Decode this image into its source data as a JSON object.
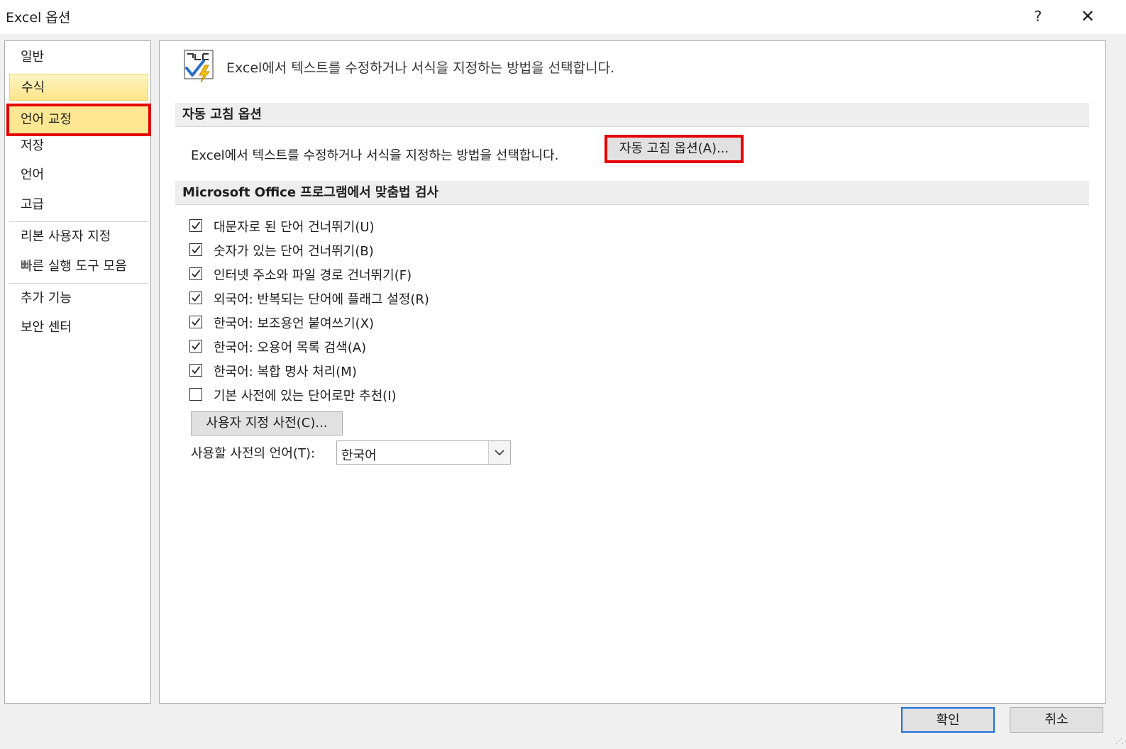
{
  "window": {
    "title": "Excel 옵션",
    "help_glyph": "?",
    "close_glyph": "✕"
  },
  "sidebar": {
    "items": [
      {
        "label": "일반"
      },
      {
        "label": "수식"
      },
      {
        "label": "언어 교정"
      },
      {
        "label": "저장"
      },
      {
        "label": "언어"
      },
      {
        "label": "고급"
      },
      {
        "label": "리본 사용자 지정"
      },
      {
        "label": "빠른 실행 도구 모음"
      },
      {
        "label": "추가 기능"
      },
      {
        "label": "보안 센터"
      }
    ]
  },
  "main": {
    "header_icon": "abc-check-proofing-icon",
    "header_text": "Excel에서 텍스트를 수정하거나 서식을 지정하는 방법을 선택합니다.",
    "autocorrect_section": {
      "title": "자동 고침 옵션",
      "description": "Excel에서 텍스트를 수정하거나 서식을 지정하는 방법을 선택합니다.",
      "button_label": "자동 고침 옵션(A)..."
    },
    "spelling_section": {
      "title": "Microsoft Office 프로그램에서 맞춤법 검사",
      "checkboxes": [
        {
          "label": "대문자로 된 단어 건너뛰기(U)",
          "checked": true
        },
        {
          "label": "숫자가 있는 단어 건너뛰기(B)",
          "checked": true
        },
        {
          "label": "인터넷 주소와 파일 경로 건너뛰기(F)",
          "checked": true
        },
        {
          "label": "외국어: 반복되는 단어에 플래그 설정(R)",
          "checked": true
        },
        {
          "label": "한국어: 보조용언 붙여쓰기(X)",
          "checked": true
        },
        {
          "label": "한국어: 오용어 목록 검색(A)",
          "checked": true
        },
        {
          "label": "한국어: 복합 명사 처리(M)",
          "checked": true
        },
        {
          "label": "기본 사전에 있는 단어로만 추천(I)",
          "checked": false
        }
      ],
      "custom_dict_button": "사용자 지정 사전(C)...",
      "dict_language_label": "사용할 사전의 언어(T):",
      "dict_language_value": "한국어"
    }
  },
  "footer": {
    "ok_label": "확인",
    "cancel_label": "취소"
  },
  "colors": {
    "highlight_box": "#e60000",
    "selected_nav": "#fde792",
    "ok_border": "#1e6fd9"
  }
}
